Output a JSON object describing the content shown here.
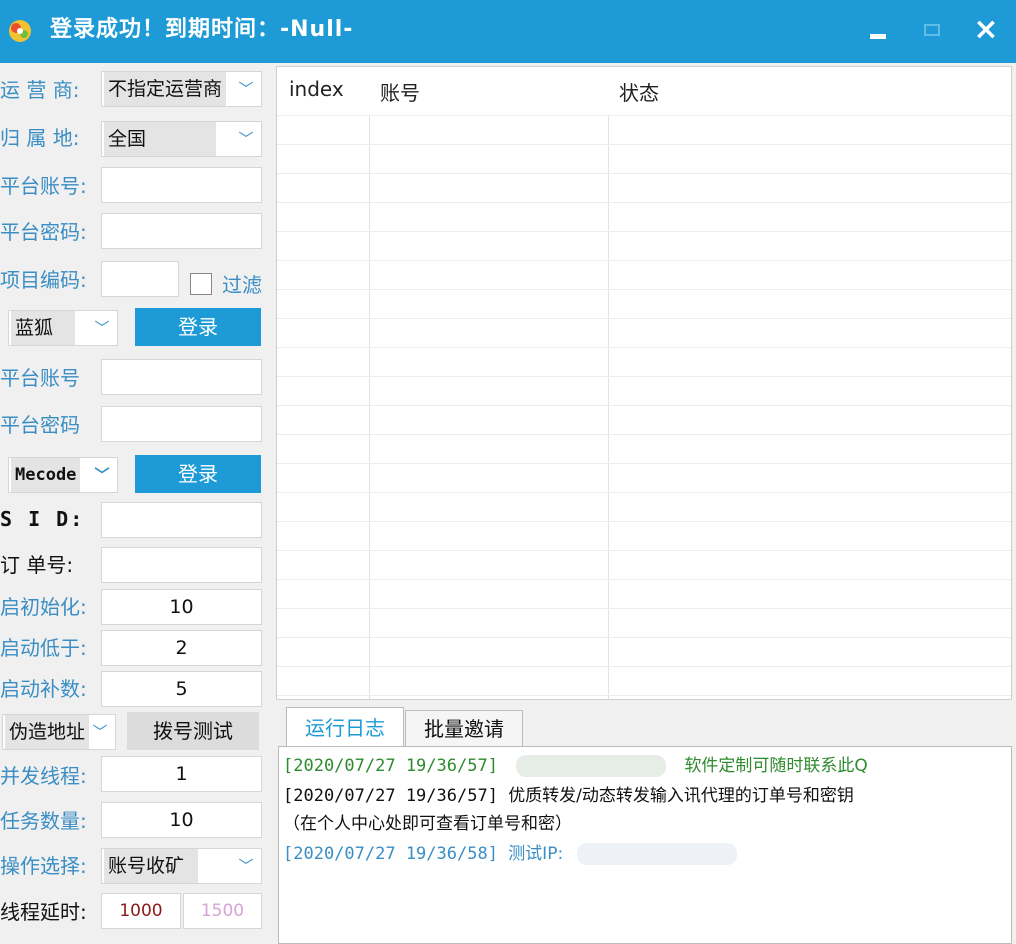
{
  "window": {
    "title": "登录成功！到期时间：-Null-",
    "icon": "app-logo-icon",
    "buttons": {
      "minimize": "minimize-icon",
      "maximize": "maximize-icon",
      "close": "×"
    }
  },
  "form": {
    "operator": {
      "label": "运 营 商:",
      "value": "不指定运营商"
    },
    "location": {
      "label": "归 属 地:",
      "value": "全国"
    },
    "account1": {
      "label": "平台账号:",
      "value": ""
    },
    "password1": {
      "label": "平台密码:",
      "value": ""
    },
    "project_code": {
      "label": "项目编码:",
      "value": "",
      "filter_label": "过滤",
      "filter_checked": false
    },
    "platform1": {
      "value": "蓝狐",
      "login": "登录"
    },
    "account2": {
      "label": "平台账号",
      "value": ""
    },
    "password2": {
      "label": "平台密码",
      "value": ""
    },
    "platform2": {
      "value": "Mecode",
      "login": "登录"
    },
    "sid": {
      "label": "S I D:",
      "value": ""
    },
    "order_no": {
      "label": "订 单号:",
      "value": ""
    },
    "init": {
      "label": "启初始化:",
      "value": "10"
    },
    "low": {
      "label": "启动低于:",
      "value": "2"
    },
    "replenish": {
      "label": "启动补数:",
      "value": "5"
    },
    "fake_location": {
      "value": "伪造地址",
      "dial_test": "拨号测试"
    },
    "threads": {
      "label": "并发线程:",
      "value": "1"
    },
    "tasks": {
      "label": "任务数量:",
      "value": "10"
    },
    "operation": {
      "label": "操作选择:",
      "value": "账号收矿"
    },
    "delay": {
      "label": "线程延时:",
      "value_from": "1000",
      "value_to": "1500"
    }
  },
  "grid": {
    "columns": [
      "index",
      "账号",
      "状态"
    ],
    "rows": []
  },
  "log": {
    "tabs": [
      "运行日志",
      "批量邀请"
    ],
    "lines": [
      {
        "time": "[2020/07/27  19/36/57]",
        "text": "软件定制可随时联系此Q",
        "color": "#2e8b2e"
      },
      {
        "time": "[2020/07/27  19/36/57]",
        "text": "优质转发/动态转发输入讯代理的订单号和密钥",
        "color": "#111111"
      },
      {
        "time": "",
        "text": "（在个人中心处即可查看订单号和密）",
        "color": "#111111"
      },
      {
        "time": "[2020/07/27  19/36/58]",
        "text": "测试IP:",
        "color": "#3a8ec4"
      }
    ]
  },
  "colors": {
    "accent": "#1e9bd7",
    "label_blue": "#3a8ec4",
    "log_green": "#2e8b2e"
  }
}
